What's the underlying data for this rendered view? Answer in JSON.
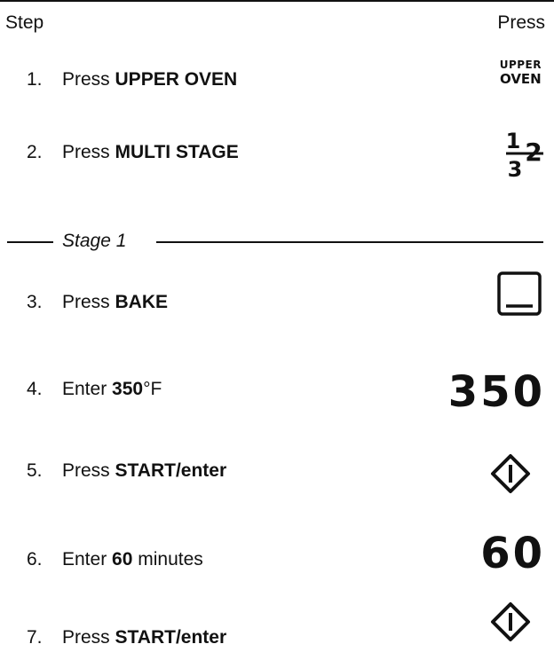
{
  "header": {
    "step_label": "Step",
    "press_label": "Press"
  },
  "steps": [
    {
      "number": "1.",
      "action": "Press ",
      "emphasis": "UPPER OVEN",
      "suffix": ""
    },
    {
      "number": "2.",
      "action": "Press ",
      "emphasis": "MULTI STAGE",
      "suffix": ""
    },
    {
      "number": "3.",
      "action": "Press ",
      "emphasis": "BAKE",
      "suffix": ""
    },
    {
      "number": "4.",
      "action": "Enter ",
      "emphasis": "350",
      "suffix": "°F"
    },
    {
      "number": "5.",
      "action": "Press ",
      "emphasis": "START/enter",
      "suffix": ""
    },
    {
      "number": "6.",
      "action": "Enter ",
      "emphasis": "60",
      "suffix": " minutes"
    },
    {
      "number": "7.",
      "action": "Press ",
      "emphasis": "START/enter",
      "suffix": ""
    }
  ],
  "stage_label": "Stage 1",
  "icons": {
    "upper_oven_line1": "UPPER",
    "upper_oven_line2": "OVEN",
    "multi_stage_glyph": "multi-stage-fraction-icon",
    "bake_glyph": "bake-icon",
    "temp_display": "350",
    "minutes_display": "60",
    "start_glyph": "start-enter-icon"
  }
}
